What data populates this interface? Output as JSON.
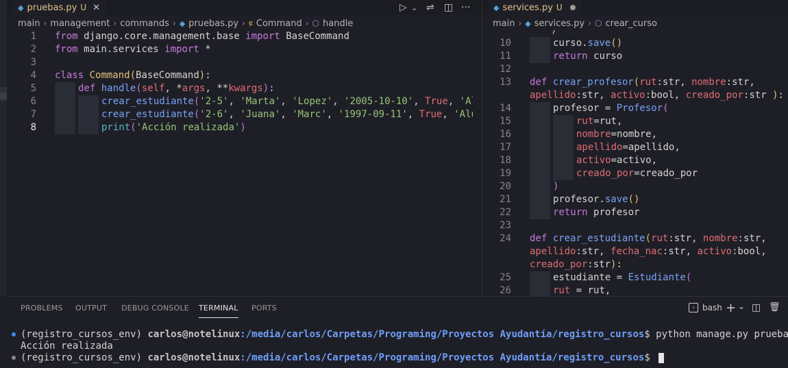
{
  "left_editor": {
    "tab": {
      "icon": "python-icon",
      "filename": "pruebas.py",
      "status": "U",
      "close_glyph": "✕"
    },
    "breadcrumb": [
      "main",
      "management",
      "commands",
      "pruebas.py",
      "Command",
      "handle"
    ],
    "line_numbers": [
      "1",
      "2",
      "3",
      "4",
      "5",
      "6",
      "7",
      "8"
    ],
    "toolbar": {
      "run": "▷",
      "run_menu": "⌄",
      "compare": "⇌",
      "split": "◫",
      "more": "···"
    }
  },
  "right_editor": {
    "tab": {
      "icon": "python-icon",
      "filename": "services.py",
      "status": "U"
    },
    "breadcrumb": [
      "main",
      "services.py",
      "crear_curso"
    ],
    "line_numbers": [
      "10",
      "11",
      "12",
      "13",
      "",
      "14",
      "15",
      "16",
      "17",
      "18",
      "19",
      "20",
      "21",
      "22",
      "23",
      "24",
      "",
      "",
      "25",
      "26"
    ]
  },
  "panel": {
    "tabs": [
      "PROBLEMS",
      "OUTPUT",
      "DEBUG CONSOLE",
      "TERMINAL",
      "PORTS"
    ],
    "active_tab": "TERMINAL",
    "terminal_label": "bash",
    "add_glyph": "+",
    "chevron_glyph": "⌄",
    "split_glyph": "◫",
    "trash_glyph": "🗑",
    "lines": [
      {
        "env": "(registro_cursos_env) ",
        "user": "carlos@notelinux",
        "path": ":/media/carlos/Carpetas/Programing/Proyectos Ayudantía/registro_cursos",
        "prompt": "$ ",
        "cmd": "python manage.py pruebas"
      },
      {
        "output": "Acción realizada"
      },
      {
        "env": "(registro_cursos_env) ",
        "user": "carlos@notelinux",
        "path": ":/media/carlos/Carpetas/Programing/Proyectos Ayudantía/registro_cursos",
        "prompt": "$ ",
        "cmd": ""
      }
    ]
  },
  "colors": {
    "bullet_blue": "#3b8eea",
    "bullet_gray": "#8a8a8a",
    "accent": "#e2c08d"
  }
}
